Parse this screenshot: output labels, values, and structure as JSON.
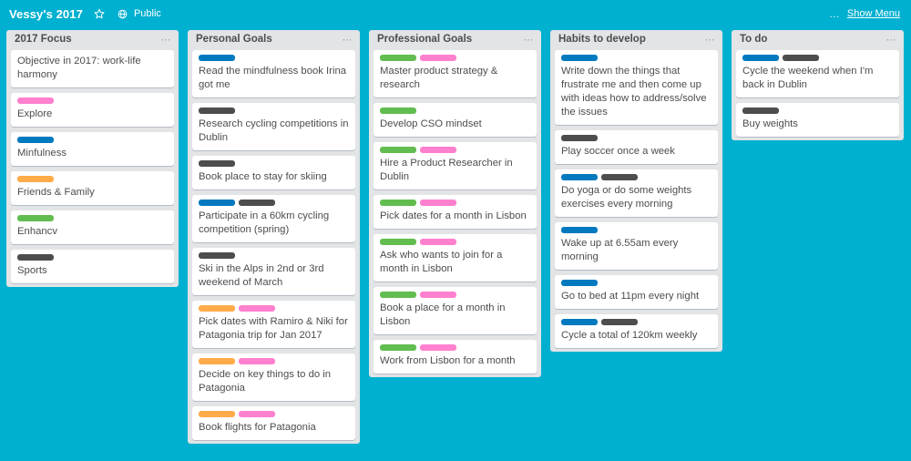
{
  "header": {
    "board_title": "Vessy's 2017",
    "star_icon": "star-icon",
    "globe_icon": "globe-icon",
    "visibility": "Public",
    "ellipsis_icon": "…",
    "show_menu": "Show Menu"
  },
  "colors": {
    "board_background": "#00b0d0",
    "list_background": "#e2e4e6",
    "card_background": "#ffffff",
    "text": "#4d4d4d",
    "label_pink": "#ff80ce",
    "label_blue": "#0079bf",
    "label_orange": "#ffab4a",
    "label_green": "#61bd4f",
    "label_black": "#4d4d4d"
  },
  "list_menu_icon": "⋯",
  "lists": [
    {
      "title": "2017 Focus",
      "cards": [
        {
          "labels": [],
          "title": "Objective in 2017: work-life harmony"
        },
        {
          "labels": [
            "#ff80ce"
          ],
          "title": "Explore"
        },
        {
          "labels": [
            "#0079bf"
          ],
          "title": "Minfulness"
        },
        {
          "labels": [
            "#ffab4a"
          ],
          "title": "Friends & Family"
        },
        {
          "labels": [
            "#61bd4f"
          ],
          "title": "Enhancv"
        },
        {
          "labels": [
            "#4d4d4d"
          ],
          "title": "Sports"
        }
      ]
    },
    {
      "title": "Personal Goals",
      "cards": [
        {
          "labels": [
            "#0079bf"
          ],
          "title": "Read the mindfulness book Irina got me"
        },
        {
          "labels": [
            "#4d4d4d"
          ],
          "title": "Research cycling competitions in Dublin"
        },
        {
          "labels": [
            "#4d4d4d"
          ],
          "title": "Book place to stay for skiing"
        },
        {
          "labels": [
            "#0079bf",
            "#4d4d4d"
          ],
          "title": "Participate in a 60km cycling competition (spring)"
        },
        {
          "labels": [
            "#4d4d4d"
          ],
          "title": "Ski in the Alps in 2nd or 3rd weekend of March"
        },
        {
          "labels": [
            "#ffab4a",
            "#ff80ce"
          ],
          "title": "Pick dates with Ramiro & Niki for Patagonia trip for Jan 2017"
        },
        {
          "labels": [
            "#ffab4a",
            "#ff80ce"
          ],
          "title": "Decide on key things to do in Patagonia"
        },
        {
          "labels": [
            "#ffab4a",
            "#ff80ce"
          ],
          "title": "Book flights for Patagonia"
        }
      ]
    },
    {
      "title": "Professional Goals",
      "cards": [
        {
          "labels": [
            "#61bd4f",
            "#ff80ce"
          ],
          "title": "Master product strategy & research"
        },
        {
          "labels": [
            "#61bd4f"
          ],
          "title": "Develop CSO mindset"
        },
        {
          "labels": [
            "#61bd4f",
            "#ff80ce"
          ],
          "title": "Hire a Product Researcher in Dublin"
        },
        {
          "labels": [
            "#61bd4f",
            "#ff80ce"
          ],
          "title": "Pick dates for a month in Lisbon"
        },
        {
          "labels": [
            "#61bd4f",
            "#ff80ce"
          ],
          "title": "Ask who wants to join for a month in Lisbon"
        },
        {
          "labels": [
            "#61bd4f",
            "#ff80ce"
          ],
          "title": "Book a place for a month in Lisbon"
        },
        {
          "labels": [
            "#61bd4f",
            "#ff80ce"
          ],
          "title": "Work from Lisbon for a month"
        }
      ]
    },
    {
      "title": "Habits to develop",
      "cards": [
        {
          "labels": [
            "#0079bf"
          ],
          "title": "Write down the things that frustrate me and then come up with ideas how to address/solve the issues"
        },
        {
          "labels": [
            "#4d4d4d"
          ],
          "title": "Play soccer once a week"
        },
        {
          "labels": [
            "#0079bf",
            "#4d4d4d"
          ],
          "title": "Do yoga or do some weights exercises every morning"
        },
        {
          "labels": [
            "#0079bf"
          ],
          "title": "Wake up at 6.55am every morning"
        },
        {
          "labels": [
            "#0079bf"
          ],
          "title": "Go to bed at 11pm every night"
        },
        {
          "labels": [
            "#0079bf",
            "#4d4d4d"
          ],
          "title": "Cycle a total of 120km weekly"
        }
      ]
    },
    {
      "title": "To do",
      "cards": [
        {
          "labels": [
            "#0079bf",
            "#4d4d4d"
          ],
          "title": "Cycle the weekend when I'm back in Dublin"
        },
        {
          "labels": [
            "#4d4d4d"
          ],
          "title": "Buy weights"
        }
      ]
    }
  ]
}
